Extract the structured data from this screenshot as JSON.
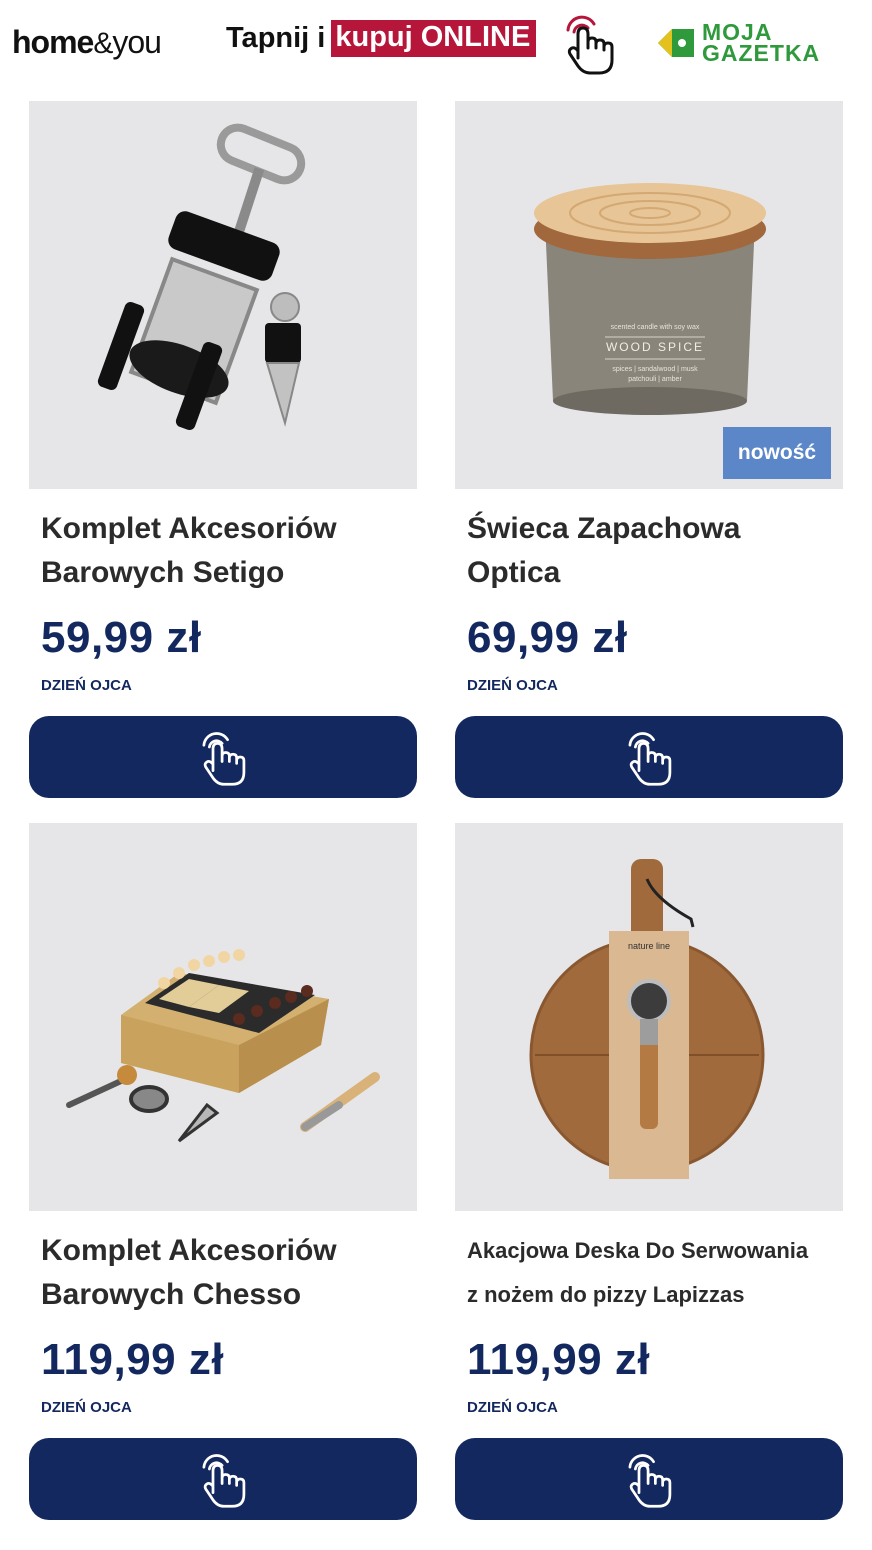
{
  "header": {
    "brand_home": "home",
    "brand_amp": "&",
    "brand_you": "you",
    "promo_prefix": "Tapnij i",
    "promo_highlight": "kupuj ONLINE",
    "gazetka_line1": "MOJA",
    "gazetka_line2": "GAZETKA",
    "colors": {
      "promo_bg": "#b5163a",
      "gazetka_green": "#2e9a3c"
    }
  },
  "products": [
    {
      "title_line1": "Komplet Akcesoriów",
      "title_line2": "Barowych Setigo",
      "price": "59,99 zł",
      "tag": "DZIEŃ OJCA",
      "image_icon": "corkscrew-image"
    },
    {
      "title_line1": "Świeca Zapachowa",
      "title_line2": "Optica",
      "price": "69,99 zł",
      "tag": "DZIEŃ OJCA",
      "badge": "nowość",
      "image_icon": "candle-image",
      "candle_label_small": "scented candle with soy wax",
      "candle_label_big": "WOOD SPICE",
      "candle_label_notes1": "spices | sandalwood | musk",
      "candle_label_notes2": "patchouli | amber"
    },
    {
      "title_line1": "Komplet Akcesoriów",
      "title_line2": "Barowych Chesso",
      "price": "119,99 zł",
      "tag": "DZIEŃ OJCA",
      "image_icon": "chess-set-image"
    },
    {
      "title_line1": "Akacjowa Deska Do Serwowania",
      "title_line2": "z nożem do pizzy Lapizzas",
      "price": "119,99 zł",
      "tag": "DZIEŃ OJCA",
      "image_icon": "serving-board-image",
      "package_label": "nature line"
    }
  ],
  "colors": {
    "navy": "#13285e",
    "badge_blue": "#5b86c8",
    "image_bg": "#e6e6e8"
  }
}
